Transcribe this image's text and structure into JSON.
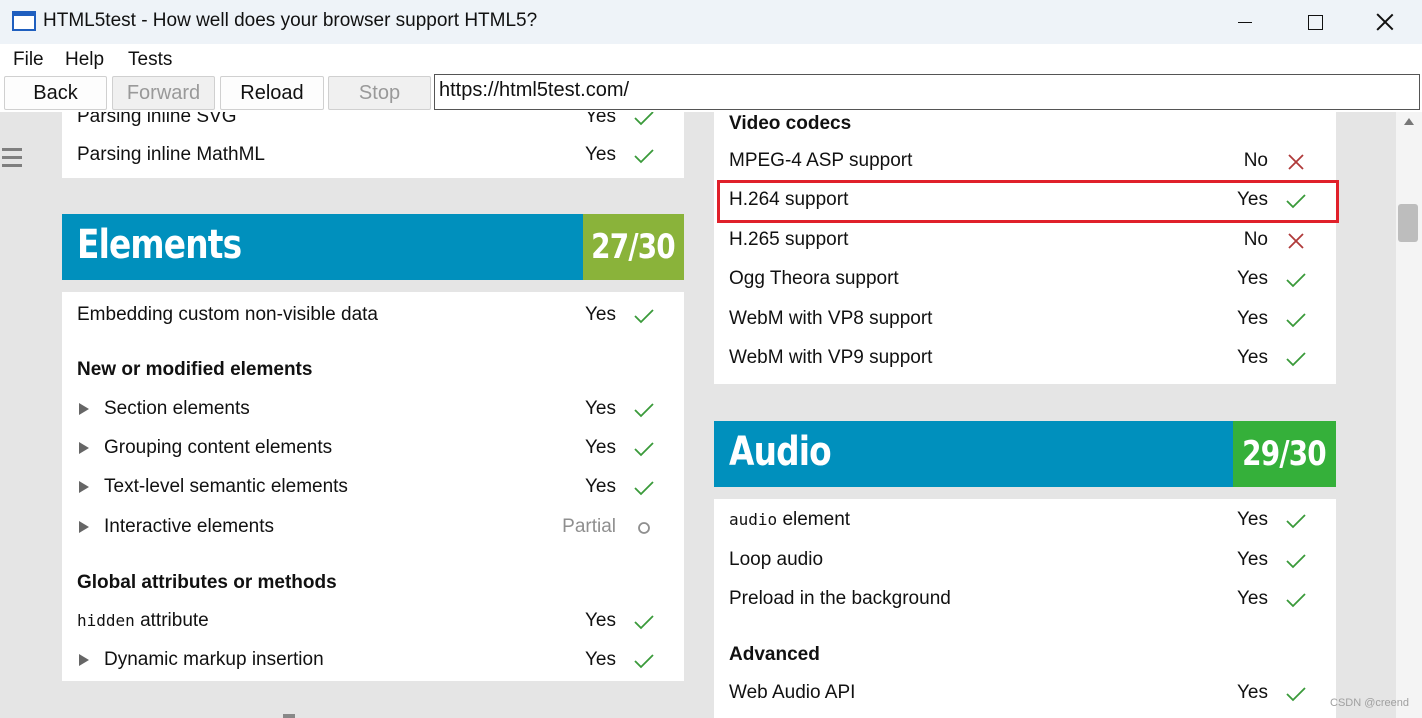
{
  "window": {
    "title": "HTML5test - How well does your browser support HTML5?",
    "controls": [
      "minimize",
      "maximize",
      "close"
    ]
  },
  "menu": {
    "file": "File",
    "help": "Help",
    "tests": "Tests"
  },
  "toolbar": {
    "back": "Back",
    "forward": "Forward",
    "reload": "Reload",
    "stop": "Stop",
    "url": "https://html5test.com/"
  },
  "left": {
    "top_rows": [
      {
        "label": "Parsing inline SVG",
        "value": "Yes",
        "status": "yes"
      },
      {
        "label": "Parsing inline MathML",
        "value": "Yes",
        "status": "yes"
      }
    ],
    "elements_banner": {
      "title": "Elements",
      "score": "27/30"
    },
    "elements_rows": {
      "custom_data": {
        "label": "Embedding custom non-visible data",
        "value": "Yes"
      },
      "new_heading": "New or modified elements",
      "section": {
        "label": "Section elements",
        "value": "Yes"
      },
      "grouping": {
        "label": "Grouping content elements",
        "value": "Yes"
      },
      "text_level": {
        "label": "Text-level semantic elements",
        "value": "Yes"
      },
      "interactive": {
        "label": "Interactive elements",
        "value": "Partial"
      },
      "global_heading": "Global attributes or methods",
      "hidden_code": "hidden",
      "hidden_label": " attribute",
      "hidden_value": "Yes",
      "dynamic": {
        "label": "Dynamic markup insertion",
        "value": "Yes"
      }
    }
  },
  "right": {
    "video_heading": "Video codecs",
    "video_rows": {
      "mpeg4": {
        "label": "MPEG-4 ASP support",
        "value": "No"
      },
      "h264": {
        "label": "H.264 support",
        "value": "Yes"
      },
      "h265": {
        "label": "H.265 support",
        "value": "No"
      },
      "theora": {
        "label": "Ogg Theora support",
        "value": "Yes"
      },
      "vp8": {
        "label": "WebM with VP8 support",
        "value": "Yes"
      },
      "vp9": {
        "label": "WebM with VP9 support",
        "value": "Yes"
      }
    },
    "audio_banner": {
      "title": "Audio",
      "score": "29/30"
    },
    "audio_rows": {
      "audio_code": "audio",
      "audio_label": " element",
      "audio_value": "Yes",
      "loop": {
        "label": "Loop audio",
        "value": "Yes"
      },
      "preload": {
        "label": "Preload in the background",
        "value": "Yes"
      },
      "advanced_heading": "Advanced",
      "webaudio": {
        "label": "Web Audio API",
        "value": "Yes"
      }
    }
  },
  "colors": {
    "banner_blue": "#0090bd",
    "elements_score_bg": "#8ab33a",
    "audio_score_bg": "#35b03a",
    "check_green": "#3a9a3a",
    "cross_red": "#b03a3a",
    "highlight_red": "#e0202a"
  },
  "watermark": "CSDN @creend"
}
